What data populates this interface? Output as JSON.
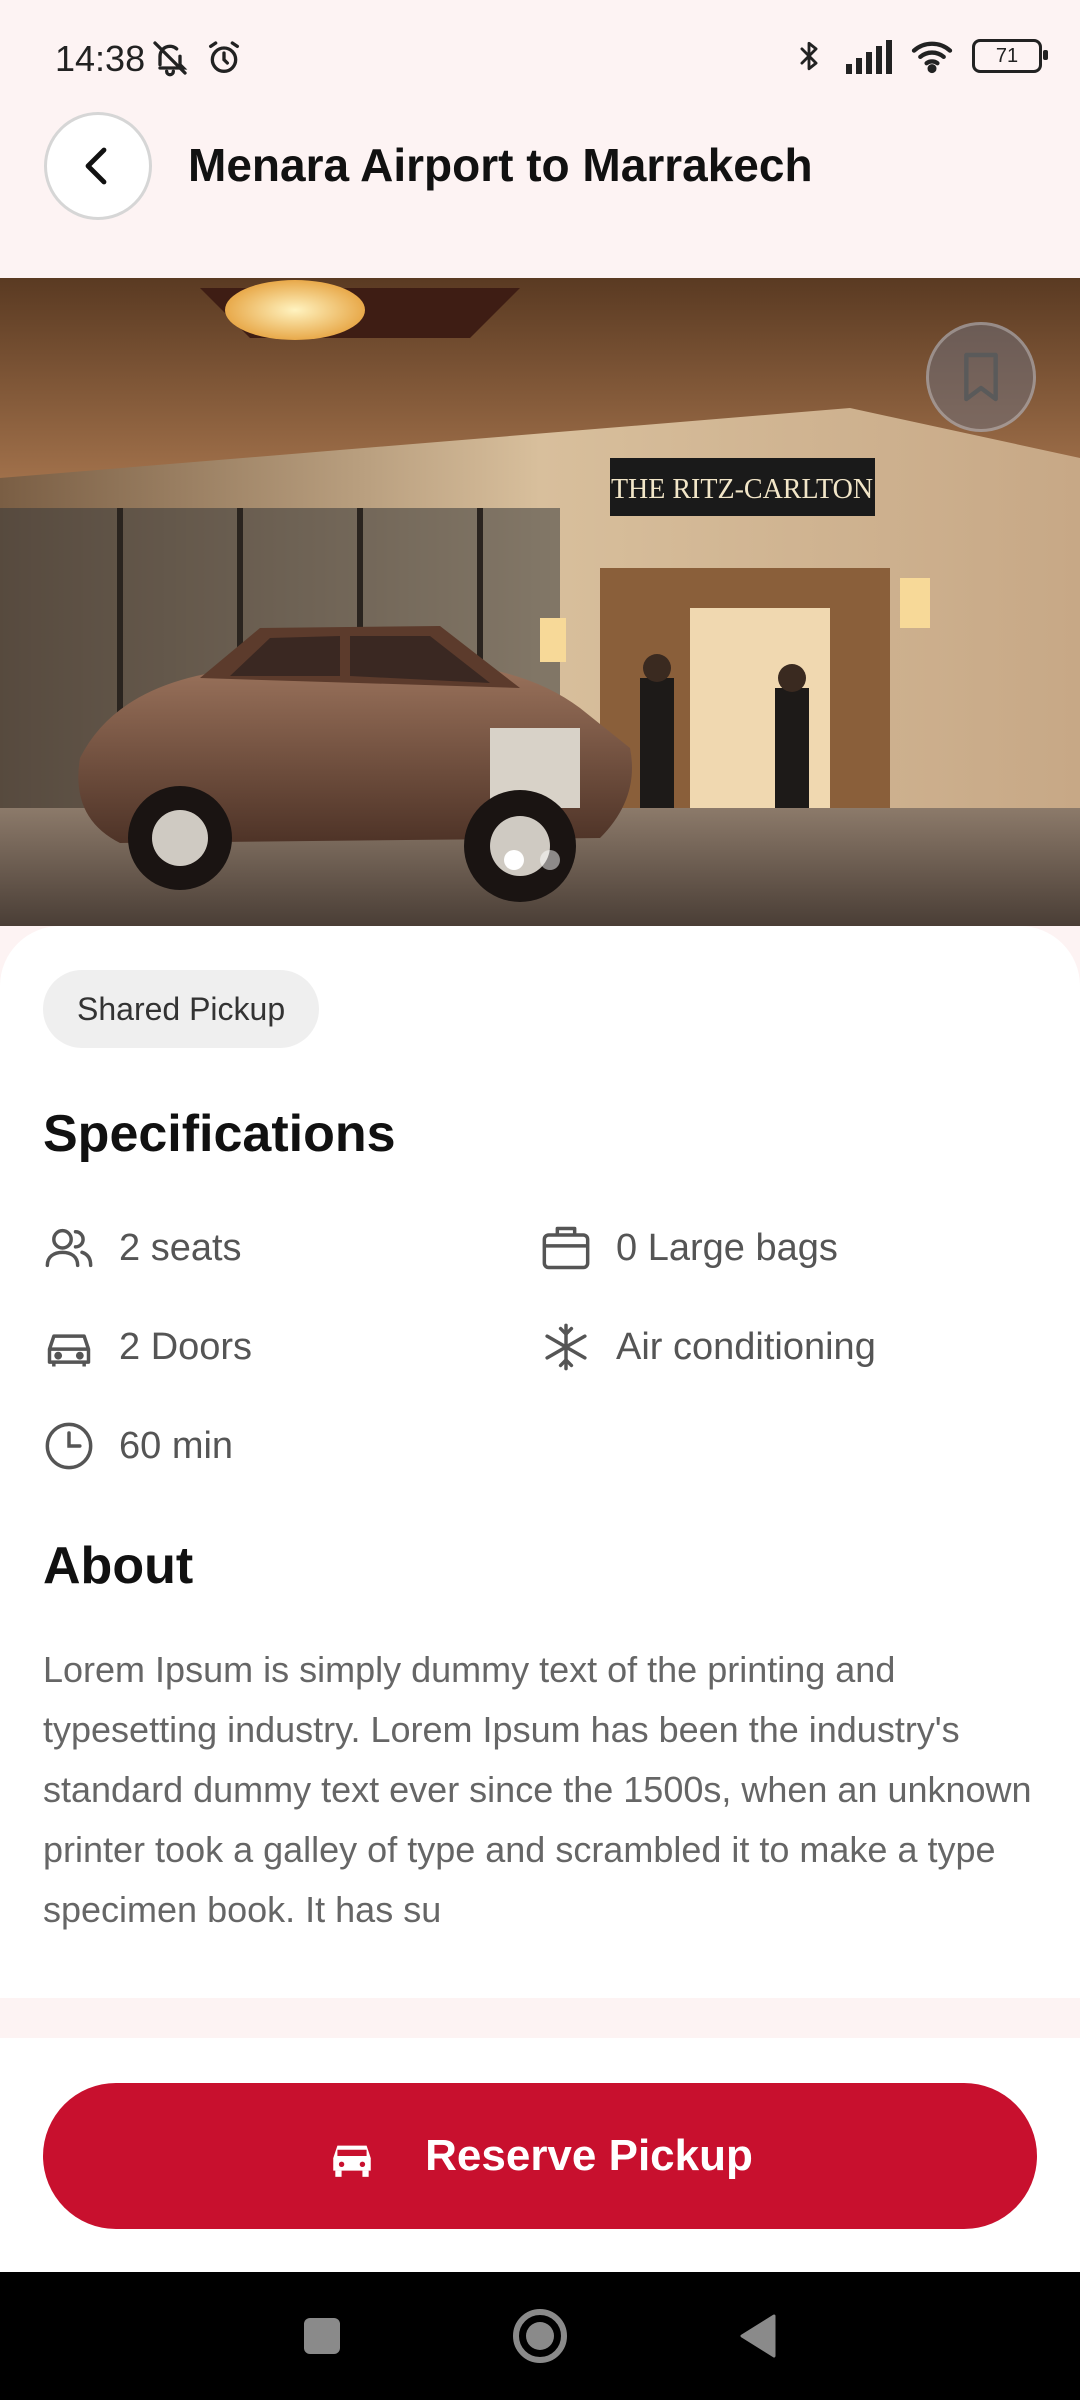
{
  "status_bar": {
    "time": "14:38",
    "battery": "71",
    "icons": [
      "mute-icon",
      "alarm-icon",
      "bluetooth-icon",
      "signal-icon",
      "wifi-icon",
      "battery-icon"
    ]
  },
  "header": {
    "title": "Menara Airport to Marrakech",
    "back_icon": "chevron-left-icon"
  },
  "hero": {
    "sign_text": "THE RITZ-CARLTON",
    "bookmark_icon": "bookmark-icon",
    "carousel": {
      "total": 2,
      "active_index": 0
    }
  },
  "tag": {
    "label": "Shared Pickup"
  },
  "specifications": {
    "title": "Specifications",
    "items": [
      {
        "icon": "users-icon",
        "label": "2 seats"
      },
      {
        "icon": "briefcase-icon",
        "label": "0 Large bags"
      },
      {
        "icon": "car-icon",
        "label": "2 Doors"
      },
      {
        "icon": "snowflake-icon",
        "label": "Air conditioning"
      },
      {
        "icon": "clock-icon",
        "label": "60 min"
      }
    ]
  },
  "about": {
    "title": "About",
    "text": "Lorem Ipsum is simply dummy text of the printing and typesetting industry. Lorem Ipsum has been the industry's standard dummy text ever since the 1500s, when an unknown printer took a galley of type and scrambled it to make a type specimen book. It has su"
  },
  "reserve": {
    "label": "Reserve Pickup",
    "icon": "car-icon"
  },
  "colors": {
    "accent": "#c8102e",
    "background": "#fdf3f3"
  },
  "nav": {
    "icons": [
      "recents-square-icon",
      "home-circle-icon",
      "back-triangle-icon"
    ]
  }
}
